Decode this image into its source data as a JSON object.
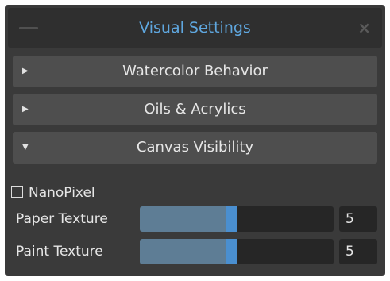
{
  "window": {
    "title": "Visual Settings",
    "close_symbol": "×",
    "minimize_icon": "minimize-dash-icon"
  },
  "sections": [
    {
      "label": "Watercolor Behavior",
      "expanded": false,
      "arrow": "▶"
    },
    {
      "label": "Oils & Acrylics",
      "expanded": false,
      "arrow": "▶"
    },
    {
      "label": "Canvas Visibility",
      "expanded": true,
      "arrow": "▼"
    }
  ],
  "nanopixel": {
    "label": "NanoPixel",
    "checked": false
  },
  "sliders": [
    {
      "label": "Paper Texture",
      "value": "5",
      "level": 0.5
    },
    {
      "label": "Paint Texture",
      "value": "5",
      "level": 0.5
    }
  ],
  "colors": {
    "panel": "#3a3a3a",
    "title_text": "#5fa7df",
    "section_bg": "#4e4e4e",
    "slider_fill": "#5e7d95",
    "slider_handle": "#4a8fd0"
  }
}
